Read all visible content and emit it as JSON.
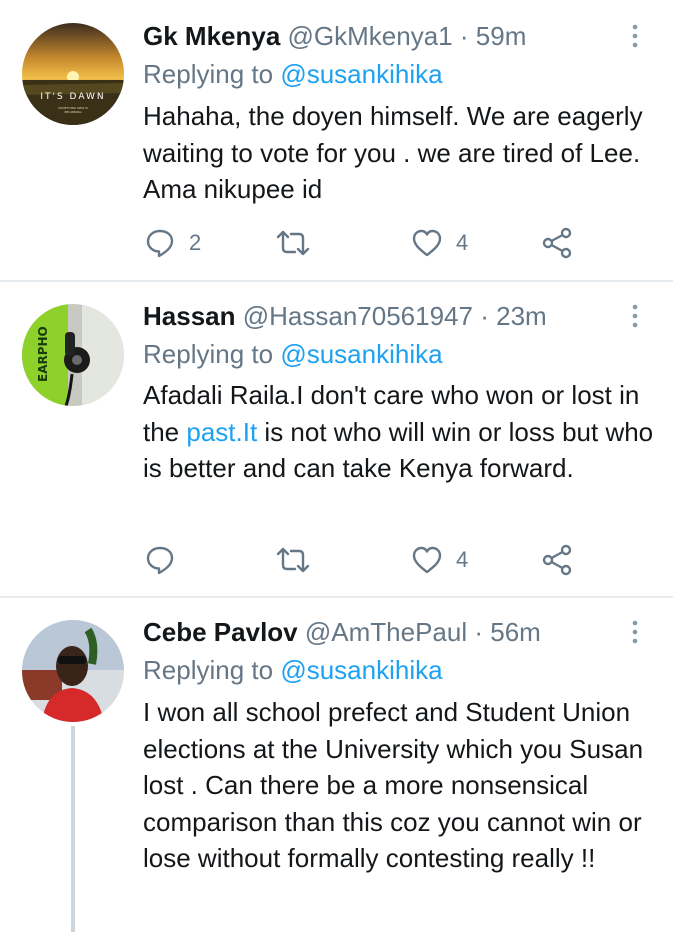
{
  "tweets": [
    {
      "name": "Gk Mkenya",
      "handle": "@GkMkenya1",
      "sep": "·",
      "time": "59m",
      "replying_prefix": "Replying to",
      "replying_to": "@susankihika",
      "text": "Hahaha, the doyen himself. We are eagerly waiting to vote for you . we are tired of Lee. Ama nikupee id",
      "avatar_caption": "IT'S DAWN",
      "avatar_subcaption": "SOMETHING NEW IS BEGINNING",
      "reply_count": "2",
      "retweet_count": "",
      "like_count": "4"
    },
    {
      "name": "Hassan",
      "handle": "@Hassan70561947",
      "sep": "·",
      "time": "23m",
      "replying_prefix": "Replying to",
      "replying_to": "@susankihika",
      "text_before_link": "Afadali Raila.I don't care who won or  lost in the ",
      "text_link": "past.It",
      "text_after_link": " is not who will win or loss but who is  better and can take Kenya forward.",
      "avatar_caption": "EARPHO",
      "reply_count": "",
      "retweet_count": "",
      "like_count": "4"
    },
    {
      "name": "Cebe Pavlov",
      "handle": "@AmThePaul",
      "sep": "·",
      "time": "56m",
      "replying_prefix": "Replying to",
      "replying_to": "@susankihika",
      "text": "I won all school prefect and Student Union elections at the University which you Susan lost . Can there be a more nonsensical comparison than this coz you cannot win or lose without formally contesting really !!"
    }
  ],
  "colors": {
    "link": "#1da1f2",
    "muted": "#657786",
    "text": "#14171a",
    "divider": "#e6ecf0"
  },
  "icons": [
    "reply-icon",
    "retweet-icon",
    "like-icon",
    "share-icon",
    "more-icon"
  ]
}
